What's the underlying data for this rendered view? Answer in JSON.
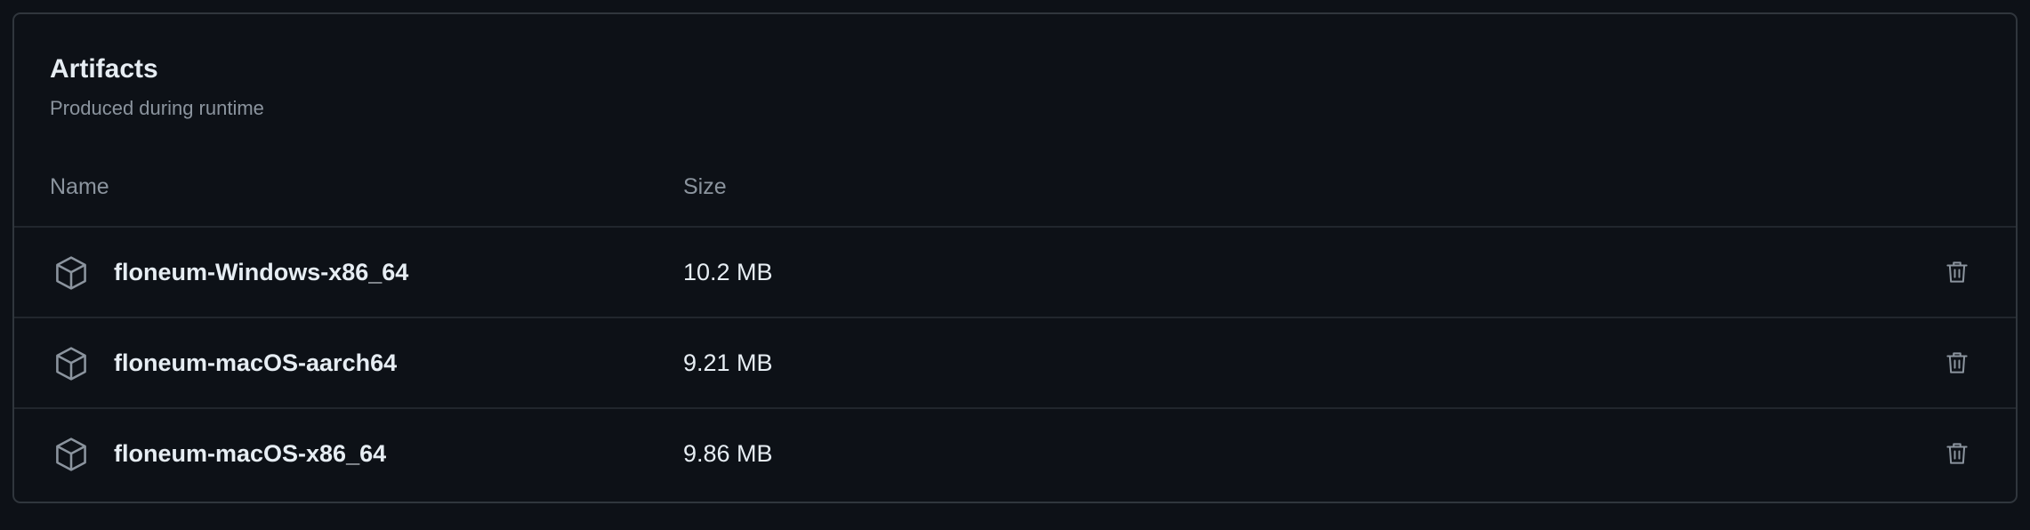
{
  "artifacts": {
    "title": "Artifacts",
    "subtitle": "Produced during runtime",
    "columns": {
      "name": "Name",
      "size": "Size"
    },
    "rows": [
      {
        "name": "floneum-Windows-x86_64",
        "size": "10.2 MB",
        "icon": "package-icon",
        "action_icon": "trash-icon"
      },
      {
        "name": "floneum-macOS-aarch64",
        "size": "9.21 MB",
        "icon": "package-icon",
        "action_icon": "trash-icon"
      },
      {
        "name": "floneum-macOS-x86_64",
        "size": "9.86 MB",
        "icon": "package-icon",
        "action_icon": "trash-icon"
      }
    ]
  },
  "colors": {
    "background": "#0d1117",
    "border": "#30363d",
    "text_primary": "#e6edf3",
    "text_muted": "#8b949e"
  }
}
